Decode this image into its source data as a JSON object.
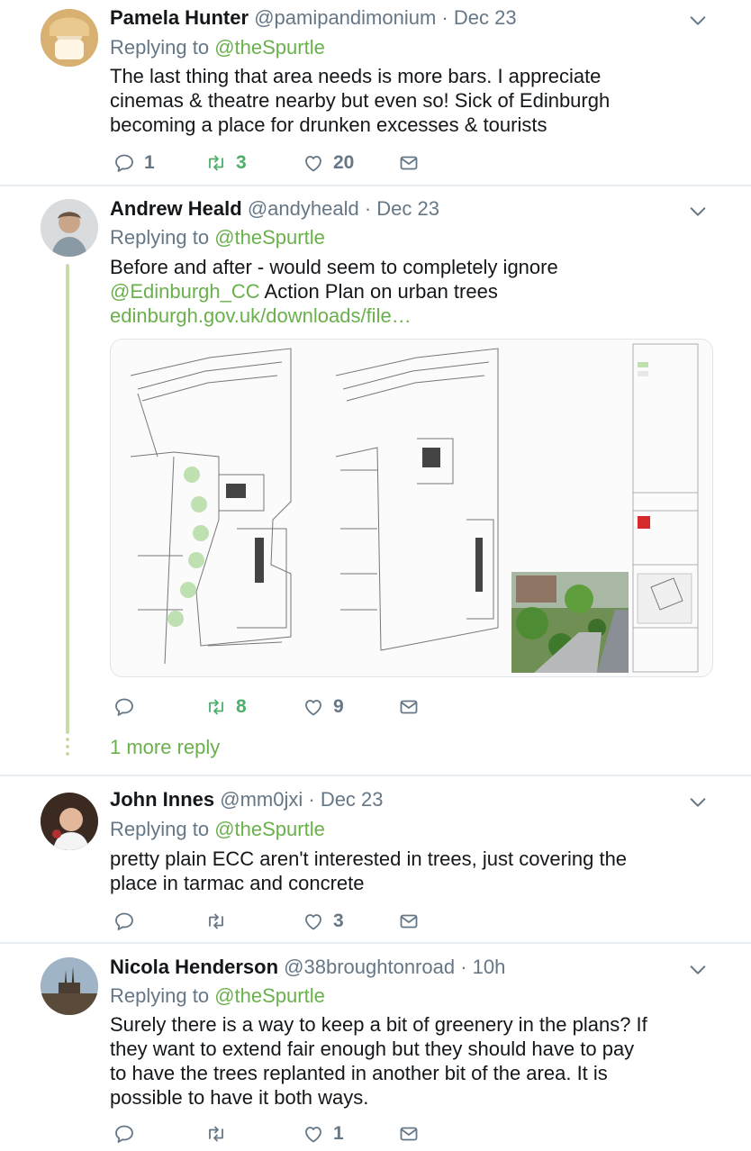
{
  "tweets": [
    {
      "name": "Pamela Hunter",
      "handle": "@pamipandimonium",
      "date": "· Dec 23",
      "replying_prefix": "Replying to",
      "replying_to": "@theSpurtle",
      "lines": [
        "The last thing that area needs is more bars. I appreciate",
        "cinemas & theatre nearby but even so! Sick of Edinburgh",
        "becoming a place for drunken excesses & tourists"
      ],
      "replies": "1",
      "retweets": "3",
      "likes": "20"
    },
    {
      "name": "Andrew Heald",
      "handle": "@andyheald",
      "date": "· Dec 23",
      "replying_prefix": "Replying to",
      "replying_to": "@theSpurtle",
      "line1": "Before and after - would seem to completely ignore",
      "mention": "@Edinburgh_CC",
      "line2_rest": " Action Plan on urban trees",
      "link": "edinburgh.gov.uk/downloads/file…",
      "replies": "",
      "retweets": "8",
      "likes": "9",
      "more_reply": "1 more reply"
    },
    {
      "name": "John Innes",
      "handle": "@mm0jxi",
      "date": "· Dec 23",
      "replying_prefix": "Replying to",
      "replying_to": "@theSpurtle",
      "lines": [
        "pretty plain ECC aren't interested in trees, just covering the",
        "place in tarmac and concrete"
      ],
      "replies": "",
      "retweets": "",
      "likes": "3"
    },
    {
      "name": "Nicola Henderson",
      "handle": "@38broughtonroad",
      "date": "· 10h",
      "replying_prefix": "Replying to",
      "replying_to": "@theSpurtle",
      "lines": [
        "Surely there is a way to keep a bit of greenery in the plans? If",
        "they want to extend fair enough but they should have to pay",
        "to have the trees replanted in another bit of the area. It is",
        "possible to have it both ways."
      ],
      "replies": "",
      "retweets": "",
      "likes": "1"
    }
  ],
  "icons": {
    "reply": "reply-icon",
    "retweet": "retweet-icon",
    "like": "heart-icon",
    "dm": "envelope-icon",
    "menu": "chevron-down-icon"
  },
  "colors": {
    "accent": "#6ab04c",
    "retweet": "#4caf6a",
    "muted": "#657786",
    "divider": "#e6ecf0"
  }
}
